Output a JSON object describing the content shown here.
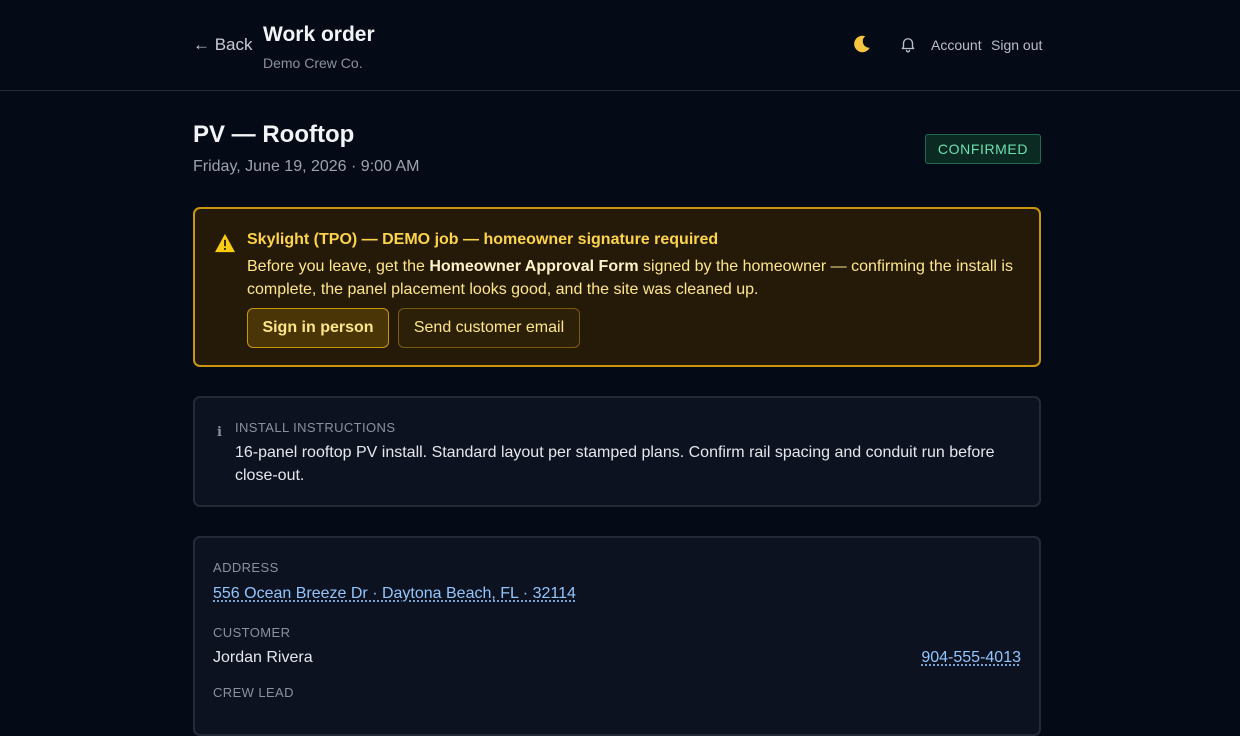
{
  "header": {
    "back_label": "← Back",
    "title": "Work order",
    "subtitle": "Demo Crew Co.",
    "theme_icon": "moon-icon",
    "notification_icon": "bell-icon",
    "account_label": "Account",
    "signout_label": "Sign out"
  },
  "job": {
    "title": "PV — Rooftop",
    "date": "Friday, June 19, 2026 · 9:00 AM",
    "status": "CONFIRMED",
    "status_color": "#6ee0b0"
  },
  "alert": {
    "icon": "warning-icon",
    "title": "Skylight (TPO) — DEMO job — homeowner signature required",
    "body_prefix": "Before you leave, get the ",
    "body_bold": "Homeowner Approval Form",
    "body_suffix": " signed by the homeowner — confirming the install is complete, the panel placement looks good, and the site was cleaned up.",
    "sign_button": "Sign in person",
    "email_button": "Send customer email",
    "accent_color": "#c8960f"
  },
  "instructions": {
    "icon": "info-icon",
    "label": "INSTALL INSTRUCTIONS",
    "text": "16-panel rooftop PV install. Standard layout per stamped plans. Confirm rail spacing and conduit run before close-out."
  },
  "details": {
    "address_label": "ADDRESS",
    "address": "556 Ocean Breeze Dr · Daytona Beach, FL · 32114",
    "customer_label": "CUSTOMER",
    "customer_name": "Jordan Rivera",
    "customer_phone": "904-555-4013",
    "crew_lead_label": "CREW LEAD",
    "link_color": "#93c5fd"
  }
}
